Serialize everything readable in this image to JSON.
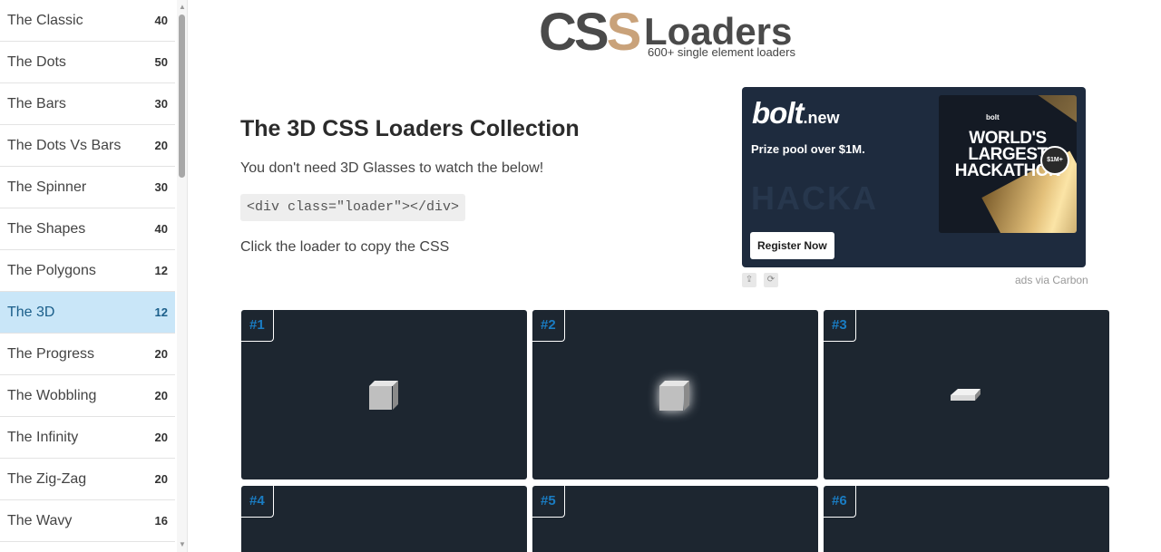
{
  "sidebar": {
    "items": [
      {
        "label": "The Classic",
        "count": "40"
      },
      {
        "label": "The Dots",
        "count": "50"
      },
      {
        "label": "The Bars",
        "count": "30"
      },
      {
        "label": "The Dots Vs Bars",
        "count": "20"
      },
      {
        "label": "The Spinner",
        "count": "30"
      },
      {
        "label": "The Shapes",
        "count": "40"
      },
      {
        "label": "The Polygons",
        "count": "12"
      },
      {
        "label": "The 3D",
        "count": "12",
        "active": true
      },
      {
        "label": "The Progress",
        "count": "20"
      },
      {
        "label": "The Wobbling",
        "count": "20"
      },
      {
        "label": "The Infinity",
        "count": "20"
      },
      {
        "label": "The Zig-Zag",
        "count": "20"
      },
      {
        "label": "The Wavy",
        "count": "16"
      }
    ]
  },
  "logo": {
    "css_text": "CS",
    "css_s": "S",
    "loaders_text": "Loaders",
    "tagline": "600+ single element loaders"
  },
  "intro": {
    "title": "The 3D CSS Loaders Collection",
    "subtitle": "You don't need 3D Glasses to watch the below!",
    "code": "<div class=\"loader\"></div>",
    "copy_hint": "Click the loader to copy the CSS"
  },
  "ad": {
    "brand": "bolt",
    "brand_suffix": ".new",
    "prize": "Prize pool over $1M.",
    "register": "Register Now",
    "background_text": "HACKA",
    "poster_top": "bolt",
    "poster_lines": [
      "WORLD'S",
      "LARGEST",
      "HACKATHON"
    ],
    "poster_badge": "$1M+",
    "via": "ads via Carbon",
    "icons": [
      "share-icon",
      "refresh-icon"
    ]
  },
  "cards": [
    {
      "num": "#1"
    },
    {
      "num": "#2"
    },
    {
      "num": "#3"
    },
    {
      "num": "#4"
    },
    {
      "num": "#5"
    },
    {
      "num": "#6"
    }
  ],
  "colors": {
    "accent": "#1a7cc2",
    "active_bg": "#c9e6f8",
    "card_bg": "#1d2630",
    "ad_bg": "#1e2b3e",
    "logo_gold": "#c9a27a"
  }
}
